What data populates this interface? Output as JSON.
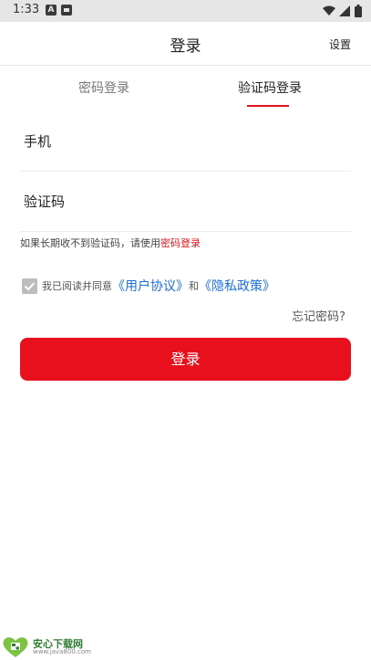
{
  "status_bar": {
    "time": "1:33",
    "icon_a": "A"
  },
  "header": {
    "title": "登录",
    "settings": "设置"
  },
  "tabs": [
    {
      "label": "密码登录",
      "active": false
    },
    {
      "label": "验证码登录",
      "active": true
    }
  ],
  "form": {
    "phone_placeholder": "手机",
    "code_placeholder": "验证码",
    "hint_text": "如果长期收不到验证码，请使用",
    "hint_link": "密码登录"
  },
  "agreement": {
    "checked": true,
    "prefix": "我已阅读并同意",
    "user_agreement": "《用户协议》",
    "and": "和",
    "privacy_policy": "《隐私政策》"
  },
  "forgot_password": "忘记密码?",
  "login_button": "登录",
  "watermark": {
    "title": "安心下载网",
    "url": "www.java800.com"
  },
  "colors": {
    "accent": "#e8101d",
    "link": "#1a6fdc"
  }
}
